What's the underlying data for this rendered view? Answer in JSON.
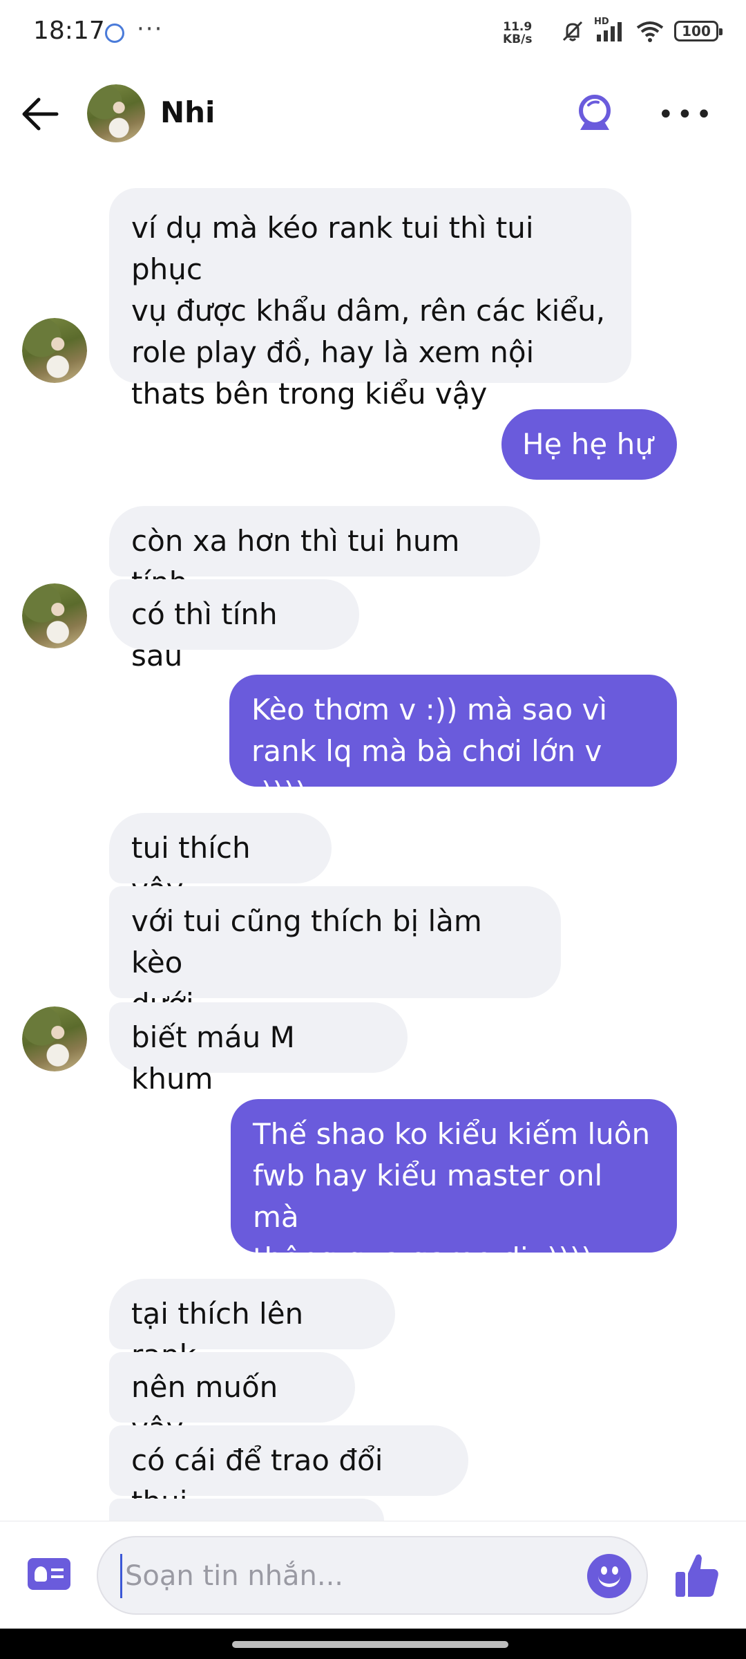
{
  "status_bar": {
    "time": "18:17",
    "more": "···",
    "net_speed_value": "11.9",
    "net_speed_unit": "KB/s",
    "network_label": "HD",
    "battery": "100"
  },
  "header": {
    "contact_name": "Nhi",
    "accent_color": "#6a5bdc"
  },
  "messages": [
    {
      "side": "in",
      "text": "ví dụ mà kéo rank tui thì tui phục\nvụ được khẩu dâm, rên các kiểu,\nrole play đồ, hay là xem nội\nthats bên trong kiểu vậy"
    },
    {
      "side": "out",
      "text": "Hẹ hẹ hự"
    },
    {
      "side": "in",
      "text": "còn xa hơn thì tui hum tính"
    },
    {
      "side": "in",
      "text": "có thì tính sau"
    },
    {
      "side": "out",
      "text": "Kèo thơm v :)) mà sao vì\nrank lq mà bà chơi lớn v :))))"
    },
    {
      "side": "in",
      "text": "tui thích vậy"
    },
    {
      "side": "in",
      "text": "với tui cũng thích bị làm kèo\ndưới"
    },
    {
      "side": "in",
      "text": "biết máu M khum"
    },
    {
      "side": "out",
      "text": "Thế shao ko kiểu kiếm luôn\nfwb hay kiểu master onl mà\nthông qua game dị :))))"
    },
    {
      "side": "in",
      "text": "tại thích lên rank"
    },
    {
      "side": "in",
      "text": "nên muốn vậy"
    },
    {
      "side": "in",
      "text": "có cái để trao đổi thui"
    }
  ],
  "composer": {
    "placeholder": "Soạn tin nhắn..."
  },
  "icons": {
    "back": "arrow-left-icon",
    "call": "video-call-icon",
    "more": "more-horizontal-icon",
    "card": "contact-card-icon",
    "emoji": "smiley-icon",
    "like": "thumbs-up-icon"
  }
}
